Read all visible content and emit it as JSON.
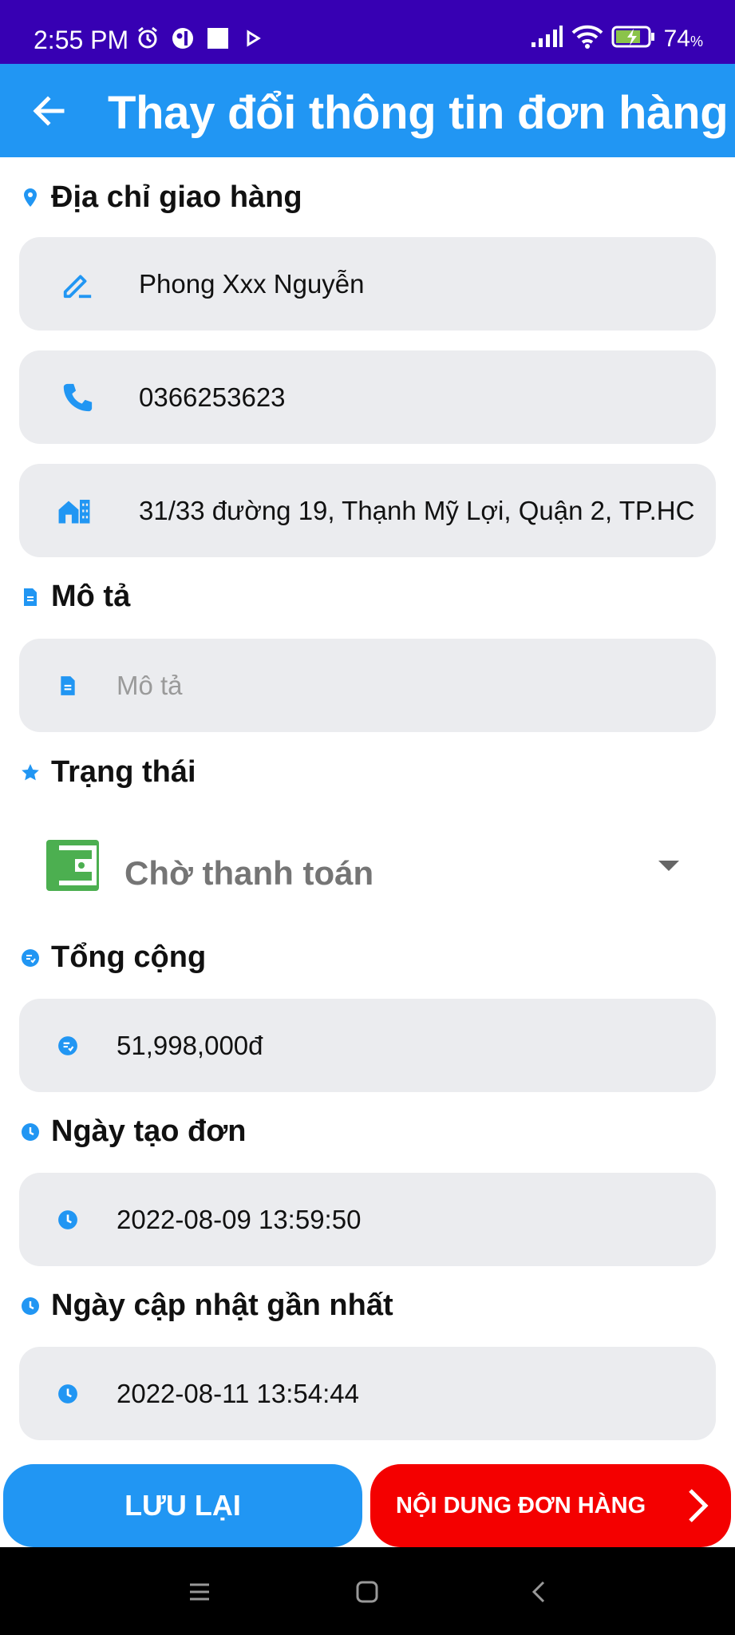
{
  "status_bar": {
    "time": "2:55 PM",
    "battery": "74",
    "battery_unit": "%"
  },
  "app_bar": {
    "title": "Thay đổi thông tin đơn hàng"
  },
  "shipping": {
    "label": "Địa chỉ giao hàng",
    "name": "Phong Xxx Nguyễn",
    "phone": "0366253623",
    "address": "31/33 đường 19, Thạnh Mỹ Lợi, Quận 2, TP.HC"
  },
  "description": {
    "label": "Mô tả",
    "placeholder": "Mô tả"
  },
  "status": {
    "label": "Trạng thái",
    "selected": "Chờ thanh toán"
  },
  "total": {
    "label": "Tổng cộng",
    "value": "51,998,000đ"
  },
  "created": {
    "label": "Ngày tạo đơn",
    "value": "2022-08-09 13:59:50"
  },
  "updated": {
    "label": "Ngày cập nhật gần nhất",
    "value": "2022-08-11 13:54:44"
  },
  "buttons": {
    "save": "LƯU LẠI",
    "order_content": "NỘI DUNG ĐƠN HÀNG"
  },
  "colors": {
    "status_bar": "#3700b3",
    "primary": "#2196f3",
    "danger": "#f40000",
    "field_bg": "#ebecef",
    "wallet_green": "#4caf50"
  }
}
